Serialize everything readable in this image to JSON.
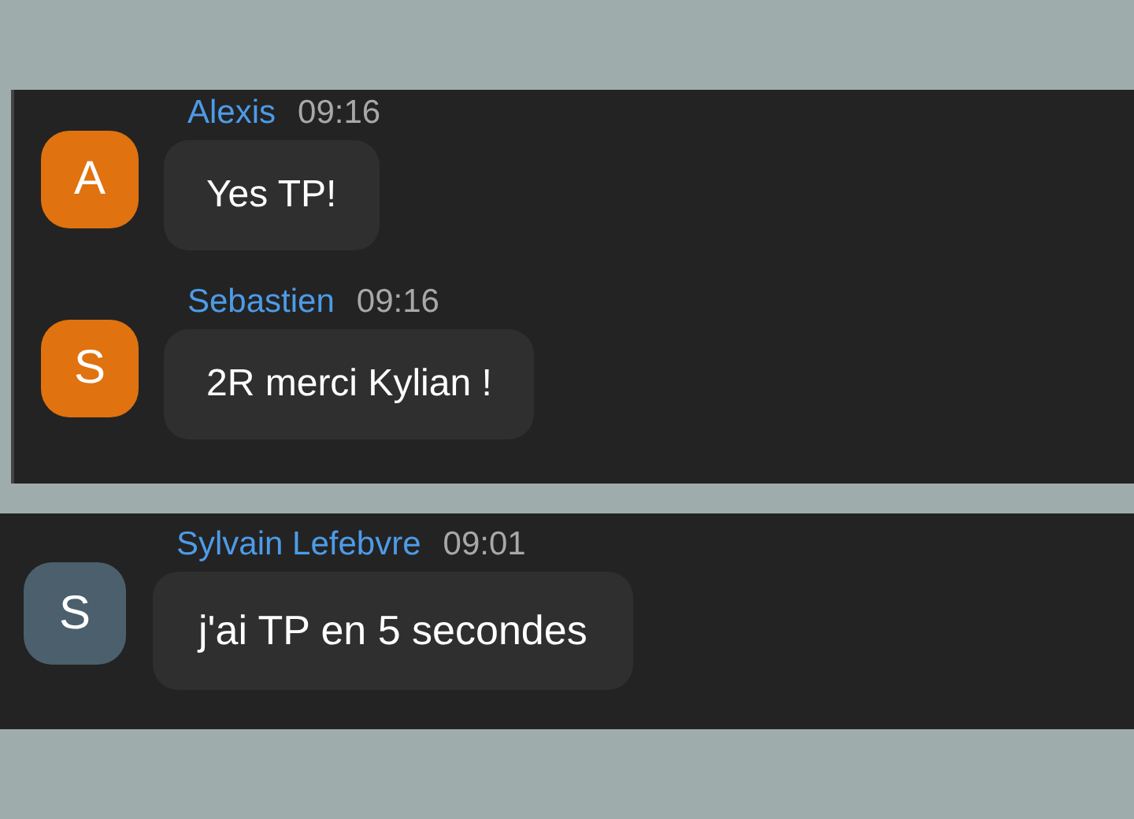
{
  "panels": [
    {
      "messages": [
        {
          "author": "Alexis",
          "time": "09:16",
          "initial": "A",
          "color": "#e0720f",
          "text": "Yes TP!"
        },
        {
          "author": "Sebastien",
          "time": "09:16",
          "initial": "S",
          "color": "#e0720f",
          "text": "2R merci Kylian !"
        }
      ]
    },
    {
      "messages": [
        {
          "author": "Sylvain Lefebvre",
          "time": "09:01",
          "initial": "S",
          "color": "#4b5f6d",
          "text": "j'ai TP en 5 secondes"
        }
      ]
    }
  ]
}
